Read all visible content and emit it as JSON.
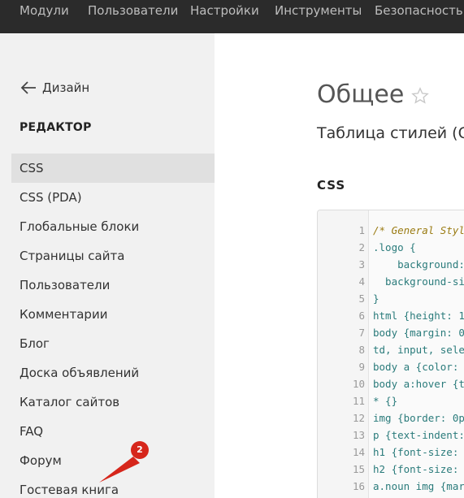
{
  "topnav": {
    "items": [
      "Модули",
      "Пользователи",
      "Настройки",
      "Инструменты",
      "Безопасность"
    ]
  },
  "sidebar": {
    "back_label": "Дизайн",
    "section_title": "РЕДАКТОР",
    "items": [
      {
        "label": "CSS",
        "active": true
      },
      {
        "label": "CSS (PDA)",
        "active": false
      },
      {
        "label": "Глобальные блоки",
        "active": false
      },
      {
        "label": "Страницы сайта",
        "active": false
      },
      {
        "label": "Пользователи",
        "active": false
      },
      {
        "label": "Комментарии",
        "active": false
      },
      {
        "label": "Блог",
        "active": false
      },
      {
        "label": "Доска объявлений",
        "active": false
      },
      {
        "label": "Каталог сайтов",
        "active": false
      },
      {
        "label": "FAQ",
        "active": false
      },
      {
        "label": "Форум",
        "active": false
      },
      {
        "label": "Гостевая книга",
        "active": false
      }
    ],
    "annotation_badge": "2"
  },
  "main": {
    "title": "Общее",
    "subtitle": "Таблица стилей (С",
    "code_label": "CSS"
  },
  "editor": {
    "lines": [
      {
        "num": "1",
        "code": "/* General Styl",
        "type": "comment"
      },
      {
        "num": "2",
        "code": ".logo {",
        "type": "code"
      },
      {
        "num": "3",
        "code": "    background:",
        "type": "code"
      },
      {
        "num": "4",
        "code": "  background-si",
        "type": "code"
      },
      {
        "num": "5",
        "code": "}",
        "type": "code"
      },
      {
        "num": "6",
        "code": "html {height: 1",
        "type": "code"
      },
      {
        "num": "7",
        "code": "body {margin: 0",
        "type": "code"
      },
      {
        "num": "8",
        "code": "td, input, sele",
        "type": "code"
      },
      {
        "num": "9",
        "code": "body a {color:",
        "type": "code"
      },
      {
        "num": "10",
        "code": "body a:hover {t",
        "type": "code"
      },
      {
        "num": "11",
        "code": "* {}",
        "type": "code"
      },
      {
        "num": "12",
        "code": "img {border: 0p",
        "type": "code"
      },
      {
        "num": "13",
        "code": "p {text-indent:",
        "type": "code"
      },
      {
        "num": "14",
        "code": "h1 {font-size:",
        "type": "code"
      },
      {
        "num": "15",
        "code": "h2 {font-size:",
        "type": "code"
      },
      {
        "num": "16",
        "code": "a.noun img {marg",
        "type": "code"
      }
    ]
  },
  "colors": {
    "topbar_bg": "#2b2b2b",
    "sidebar_bg": "#f1f1f1",
    "active_item_bg": "#e0e0e0",
    "badge_red": "#d6261b",
    "code_teal": "#2a7b7b",
    "comment_gold": "#9a7b12"
  }
}
